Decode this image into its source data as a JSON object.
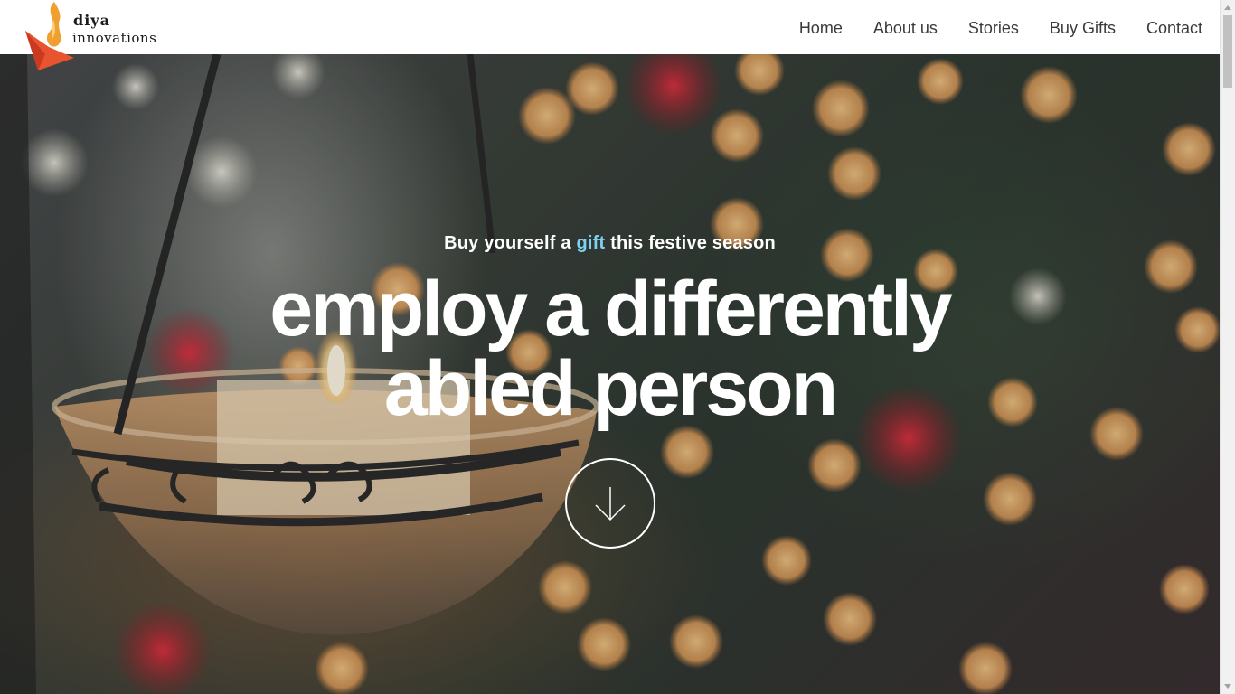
{
  "brand": {
    "line1": "diya",
    "line2": "innovations",
    "logo_icon": "flame-diya-logo-icon",
    "colors": {
      "flame": "#f0a030",
      "lamp": "#e8542f"
    }
  },
  "nav": {
    "items": [
      {
        "label": "Home"
      },
      {
        "label": "About us"
      },
      {
        "label": "Stories"
      },
      {
        "label": "Buy Gifts"
      },
      {
        "label": "Contact"
      }
    ]
  },
  "hero": {
    "subtitle_before": "Buy yourself a ",
    "subtitle_highlight": "gift",
    "subtitle_after": " this festive season",
    "headline_line1": "employ a differently",
    "headline_line2": "abled person",
    "scroll_icon": "arrow-down-icon",
    "highlight_color": "#7fd1f0"
  }
}
